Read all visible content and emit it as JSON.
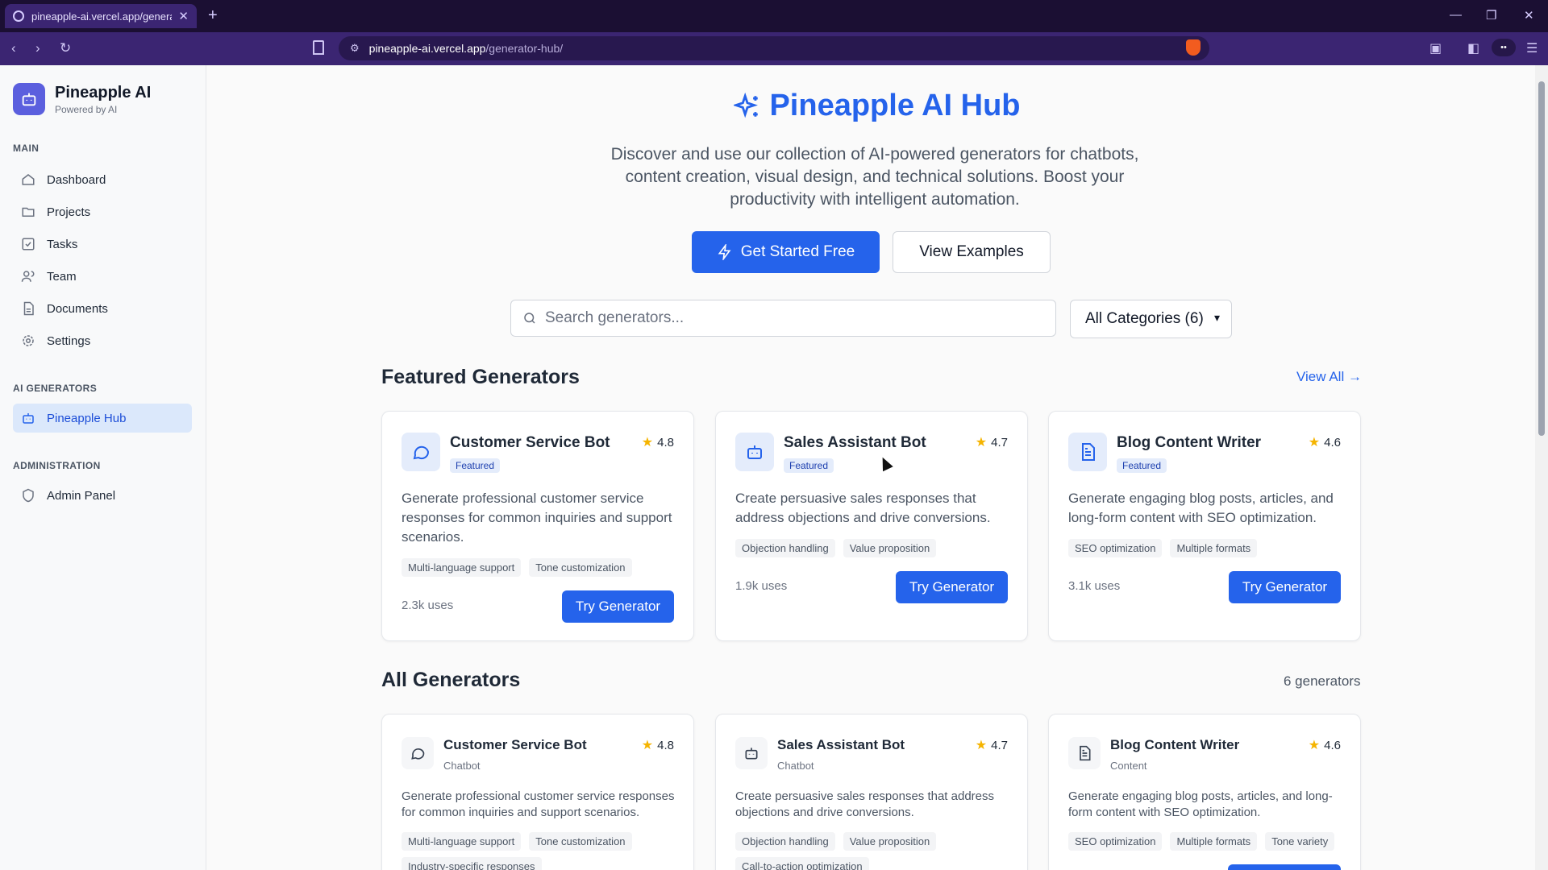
{
  "browser": {
    "tab_title": "pineapple-ai.vercel.app/generato",
    "url_host": "pineapple-ai.vercel.app",
    "url_path": "/generator-hub/"
  },
  "sidebar": {
    "brand_name": "Pineapple AI",
    "brand_sub": "Powered by AI",
    "main_label": "MAIN",
    "main_items": [
      {
        "label": "Dashboard",
        "icon": "home-icon"
      },
      {
        "label": "Projects",
        "icon": "folder-icon"
      },
      {
        "label": "Tasks",
        "icon": "check-square-icon"
      },
      {
        "label": "Team",
        "icon": "users-icon"
      },
      {
        "label": "Documents",
        "icon": "file-icon"
      },
      {
        "label": "Settings",
        "icon": "gear-icon"
      }
    ],
    "ai_label": "AI GENERATORS",
    "ai_items": [
      {
        "label": "Pineapple Hub",
        "icon": "bot-icon",
        "active": true
      }
    ],
    "admin_label": "ADMINISTRATION",
    "admin_items": [
      {
        "label": "Admin Panel",
        "icon": "shield-icon"
      }
    ]
  },
  "hero": {
    "title": "Pineapple AI Hub",
    "description": "Discover and use our collection of AI-powered generators for chatbots, content creation, visual design, and technical solutions. Boost your productivity with intelligent automation.",
    "primary_button": "Get Started Free",
    "secondary_button": "View Examples"
  },
  "search": {
    "placeholder": "Search generators...",
    "value": "",
    "category_selected": "All Categories (6)"
  },
  "featured": {
    "title": "Featured Generators",
    "view_all": "View All →",
    "cards": [
      {
        "title": "Customer Service Bot",
        "badge": "Featured",
        "rating": "4.8",
        "description": "Generate professional customer service responses for common inquiries and support scenarios.",
        "tags": [
          "Multi-language support",
          "Tone customization"
        ],
        "uses": "2.3k uses",
        "button": "Try Generator",
        "icon": "chat-bubble-icon"
      },
      {
        "title": "Sales Assistant Bot",
        "badge": "Featured",
        "rating": "4.7",
        "description": "Create persuasive sales responses that address objections and drive conversions.",
        "tags": [
          "Objection handling",
          "Value proposition"
        ],
        "uses": "1.9k uses",
        "button": "Try Generator",
        "icon": "bot-icon"
      },
      {
        "title": "Blog Content Writer",
        "badge": "Featured",
        "rating": "4.6",
        "description": "Generate engaging blog posts, articles, and long-form content with SEO optimization.",
        "tags": [
          "SEO optimization",
          "Multiple formats"
        ],
        "uses": "3.1k uses",
        "button": "Try Generator",
        "icon": "document-icon"
      }
    ]
  },
  "all": {
    "title": "All Generators",
    "count": "6 generators",
    "cards": [
      {
        "title": "Customer Service Bot",
        "category": "Chatbot",
        "rating": "4.8",
        "description": "Generate professional customer service responses for common inquiries and support scenarios.",
        "tags": [
          "Multi-language support",
          "Tone customization",
          "Industry-specific responses"
        ],
        "icon": "chat-bubble-icon"
      },
      {
        "title": "Sales Assistant Bot",
        "category": "Chatbot",
        "rating": "4.7",
        "description": "Create persuasive sales responses that address objections and drive conversions.",
        "tags": [
          "Objection handling",
          "Value proposition",
          "Call-to-action optimization"
        ],
        "icon": "bot-icon"
      },
      {
        "title": "Blog Content Writer",
        "category": "Content",
        "rating": "4.6",
        "description": "Generate engaging blog posts, articles, and long-form content with SEO optimization.",
        "tags": [
          "SEO optimization",
          "Multiple formats",
          "Tone variety"
        ],
        "icon": "document-icon"
      }
    ]
  },
  "colors": {
    "accent": "#2563eb",
    "browser_chrome": "#3b2572",
    "rating_star": "#f5b400"
  }
}
